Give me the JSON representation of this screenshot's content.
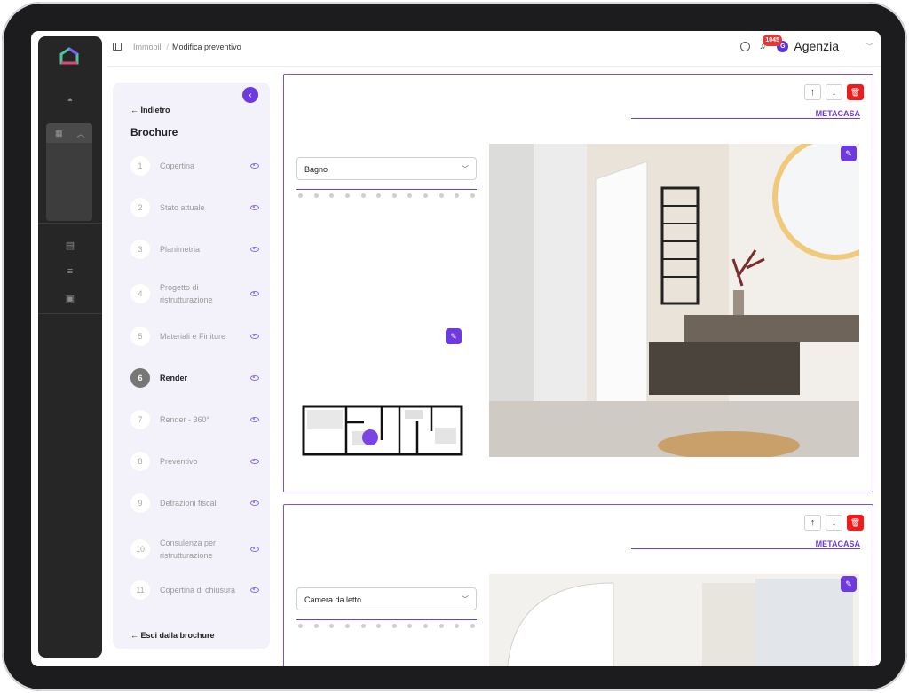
{
  "topbar": {
    "breadcrumb": [
      "Immobili",
      "Modifica preventivo"
    ],
    "notifications_count": "1045",
    "avatar_initial": "G",
    "account_name": "Agenzia"
  },
  "sidebar": {
    "back_label": "Indietro",
    "title": "Brochure",
    "steps": [
      {
        "num": "1",
        "label": "Copertina"
      },
      {
        "num": "2",
        "label": "Stato attuale"
      },
      {
        "num": "3",
        "label": "Planimetria"
      },
      {
        "num": "4",
        "label": "Progetto di ristrutturazione"
      },
      {
        "num": "5",
        "label": "Materiali e Finiture"
      },
      {
        "num": "6",
        "label": "Render"
      },
      {
        "num": "7",
        "label": "Render - 360°"
      },
      {
        "num": "8",
        "label": "Preventivo"
      },
      {
        "num": "9",
        "label": "Detrazioni fiscali"
      },
      {
        "num": "10",
        "label": "Consulenza per ristrutturazione"
      },
      {
        "num": "11",
        "label": "Copertina di chiusura"
      }
    ],
    "active_step": "6",
    "exit_label": "Esci dalla brochure"
  },
  "panels": [
    {
      "brand": "METACASA",
      "room": "Bagno"
    },
    {
      "brand": "METACASA",
      "room": "Camera da letto"
    }
  ],
  "colors": {
    "accent": "#6d3ae0",
    "delete": "#ee1c1c",
    "rail": "#262626",
    "sidebar_bg": "#f3f1f9"
  }
}
